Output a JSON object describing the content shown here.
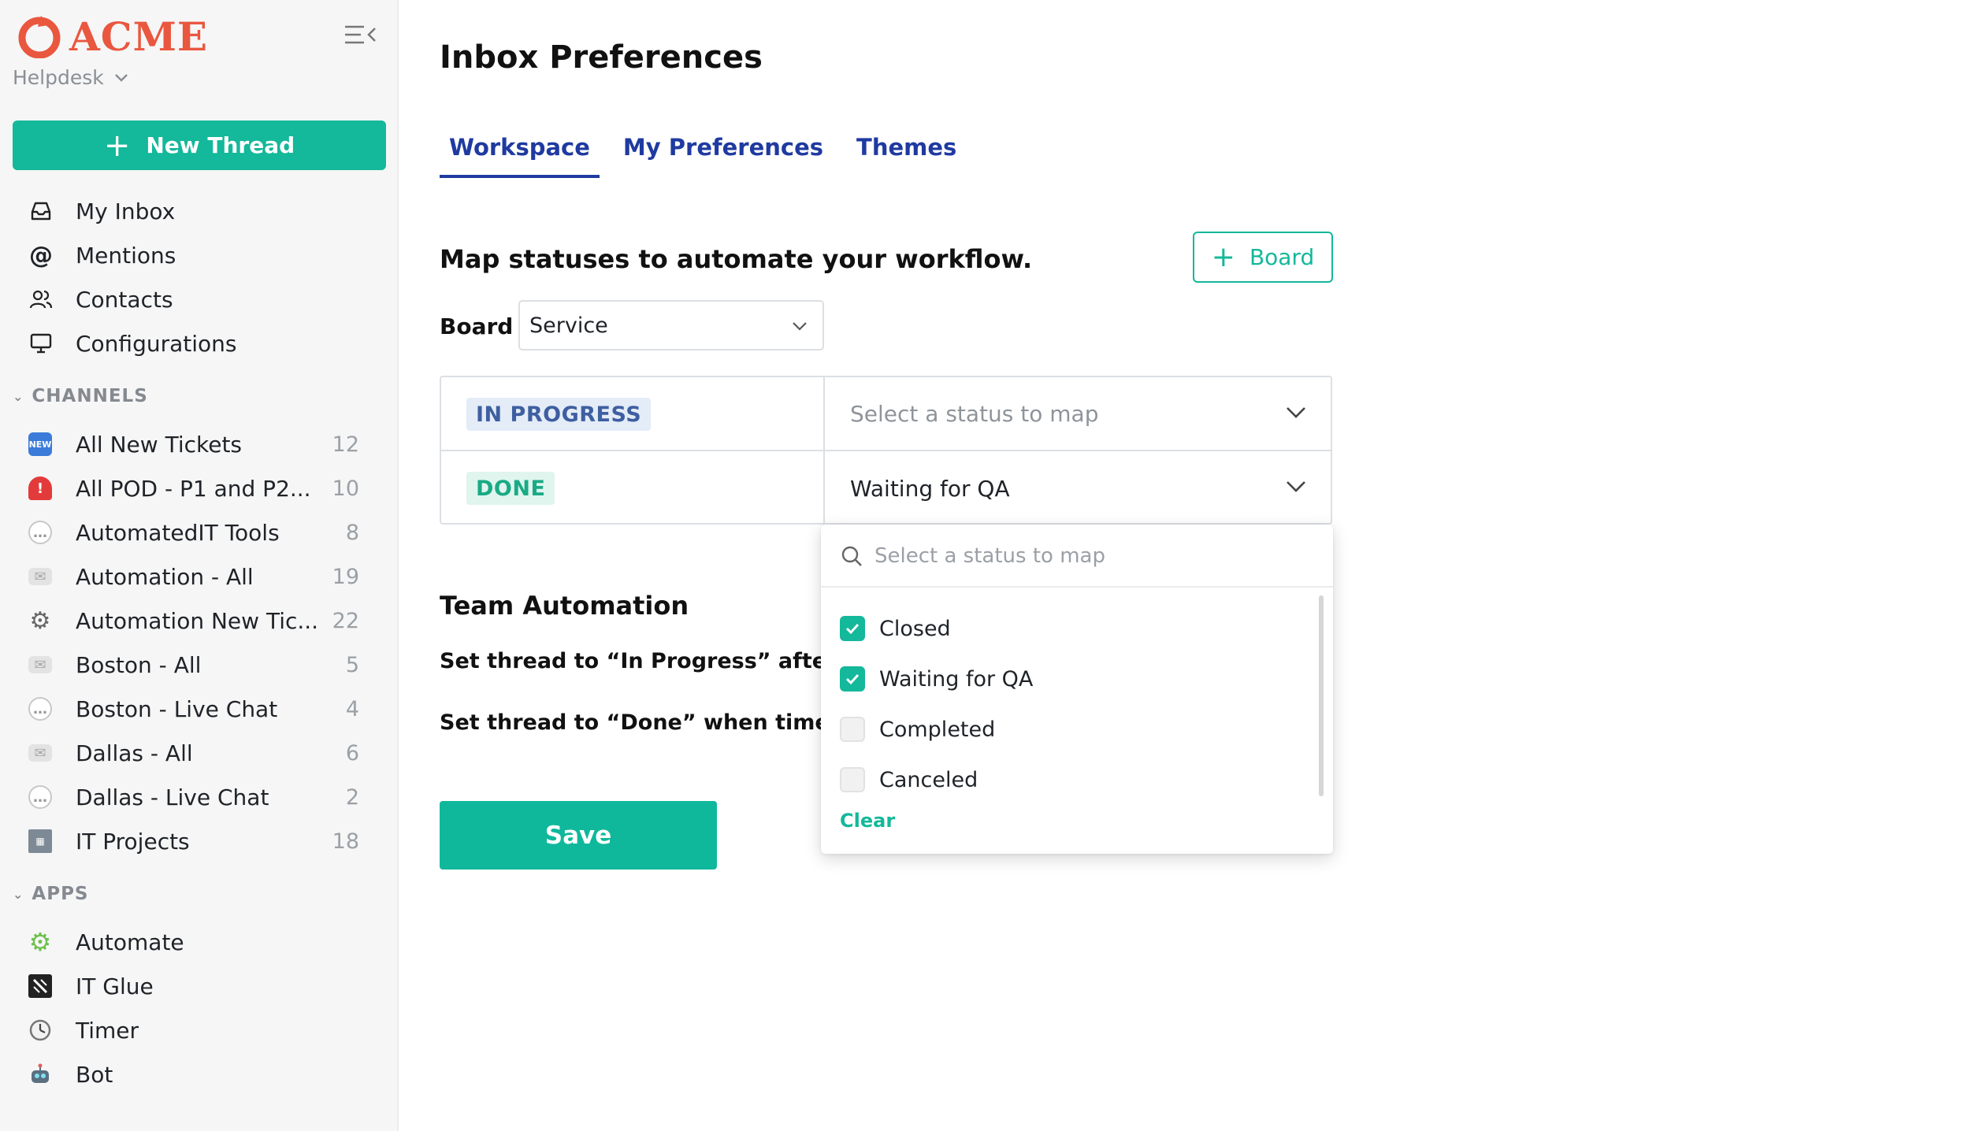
{
  "brand": {
    "name": "ACME",
    "color": "#e9573f",
    "workspace": "Helpdesk"
  },
  "colors": {
    "accent": "#14b89a",
    "tab": "#1f3aa0"
  },
  "sidebar": {
    "new_thread_label": "New Thread",
    "nav": [
      {
        "label": "My Inbox",
        "icon": "inbox-icon"
      },
      {
        "label": "Mentions",
        "icon": "at-sign-icon"
      },
      {
        "label": "Contacts",
        "icon": "contacts-icon"
      },
      {
        "label": "Configurations",
        "icon": "monitor-icon"
      }
    ],
    "channels_heading": "CHANNELS",
    "channels": [
      {
        "label": "All New Tickets",
        "count": "12",
        "icon": "new-badge-icon"
      },
      {
        "label": "All POD - P1 and P2...",
        "count": "10",
        "icon": "siren-icon"
      },
      {
        "label": "AutomatedIT Tools",
        "count": "8",
        "icon": "speech-bubble-icon"
      },
      {
        "label": "Automation - All",
        "count": "19",
        "icon": "envelope-icon"
      },
      {
        "label": "Automation New Tic...",
        "count": "22",
        "icon": "gear-icon"
      },
      {
        "label": "Boston - All",
        "count": "5",
        "icon": "envelope-icon"
      },
      {
        "label": "Boston - Live Chat",
        "count": "4",
        "icon": "speech-bubble-icon"
      },
      {
        "label": "Dallas - All",
        "count": "6",
        "icon": "envelope-icon"
      },
      {
        "label": "Dallas - Live Chat",
        "count": "2",
        "icon": "speech-bubble-icon"
      },
      {
        "label": "IT Projects",
        "count": "18",
        "icon": "building-icon"
      }
    ],
    "apps_heading": "APPS",
    "apps": [
      {
        "label": "Automate",
        "icon": "automate-gear-icon"
      },
      {
        "label": "IT Glue",
        "icon": "it-glue-icon"
      },
      {
        "label": "Timer",
        "icon": "clock-icon"
      },
      {
        "label": "Bot",
        "icon": "robot-icon"
      }
    ]
  },
  "main": {
    "title": "Inbox Preferences",
    "tabs": [
      {
        "label": "Workspace",
        "active": true
      },
      {
        "label": "My Preferences",
        "active": false
      },
      {
        "label": "Themes",
        "active": false
      }
    ],
    "section_title": "Map statuses to automate your workflow.",
    "board_button_label": "Board",
    "board_label": "Board",
    "board_value": "Service",
    "mappings": [
      {
        "status": "IN PROGRESS",
        "placeholder": "Select a status to map",
        "value": ""
      },
      {
        "status": "DONE",
        "placeholder": "Select a status to map",
        "value": "Waiting for QA"
      }
    ],
    "team_title": "Team Automation",
    "rule1": "Set thread to “In Progress” after the",
    "rule2": "Set thread to “Done” when time entr",
    "save_label": "Save"
  },
  "dropdown": {
    "search_placeholder": "Select a status to map",
    "options": [
      {
        "label": "Closed",
        "checked": true
      },
      {
        "label": "Waiting for QA",
        "checked": true
      },
      {
        "label": "Completed",
        "checked": false
      },
      {
        "label": "Canceled",
        "checked": false
      }
    ],
    "clear_label": "Clear"
  }
}
